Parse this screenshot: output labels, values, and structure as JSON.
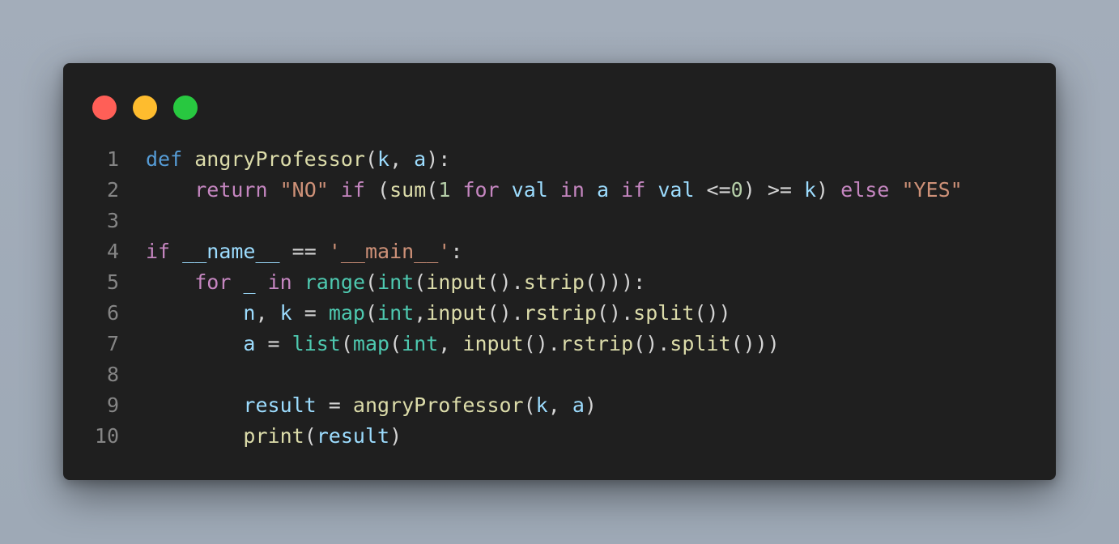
{
  "window": {
    "traffic_lights": [
      {
        "name": "close",
        "color": "#ff5f57"
      },
      {
        "name": "minimize",
        "color": "#febc2e"
      },
      {
        "name": "maximize",
        "color": "#28c840"
      }
    ]
  },
  "colors": {
    "keyword_def": "#569cd6",
    "keyword_control": "#c586c0",
    "function": "#dcdcaa",
    "variable": "#9cdcfe",
    "string": "#ce9178",
    "number": "#b5cea8",
    "builtin": "#4ec9b0",
    "default": "#d4d4d4",
    "line_number": "#858585",
    "background": "#1f1f1f"
  },
  "code": {
    "language": "python",
    "lines": [
      {
        "number": "1",
        "tokens": [
          {
            "t": "def",
            "c": "kw"
          },
          {
            "t": " ",
            "c": "op"
          },
          {
            "t": "angryProfessor",
            "c": "fn"
          },
          {
            "t": "(",
            "c": "op"
          },
          {
            "t": "k",
            "c": "var"
          },
          {
            "t": ", ",
            "c": "op"
          },
          {
            "t": "a",
            "c": "var"
          },
          {
            "t": "):",
            "c": "op"
          }
        ]
      },
      {
        "number": "2",
        "tokens": [
          {
            "t": "    ",
            "c": "op"
          },
          {
            "t": "return",
            "c": "ctl"
          },
          {
            "t": " ",
            "c": "op"
          },
          {
            "t": "\"NO\"",
            "c": "str"
          },
          {
            "t": " ",
            "c": "op"
          },
          {
            "t": "if",
            "c": "ctl"
          },
          {
            "t": " (",
            "c": "op"
          },
          {
            "t": "sum",
            "c": "fn"
          },
          {
            "t": "(",
            "c": "op"
          },
          {
            "t": "1",
            "c": "num"
          },
          {
            "t": " ",
            "c": "op"
          },
          {
            "t": "for",
            "c": "ctl"
          },
          {
            "t": " ",
            "c": "op"
          },
          {
            "t": "val",
            "c": "var"
          },
          {
            "t": " ",
            "c": "op"
          },
          {
            "t": "in",
            "c": "ctl"
          },
          {
            "t": " ",
            "c": "op"
          },
          {
            "t": "a",
            "c": "var"
          },
          {
            "t": " ",
            "c": "op"
          },
          {
            "t": "if",
            "c": "ctl"
          },
          {
            "t": " ",
            "c": "op"
          },
          {
            "t": "val",
            "c": "var"
          },
          {
            "t": " <=",
            "c": "op"
          },
          {
            "t": "0",
            "c": "num"
          },
          {
            "t": ") >= ",
            "c": "op"
          },
          {
            "t": "k",
            "c": "var"
          },
          {
            "t": ") ",
            "c": "op"
          },
          {
            "t": "else",
            "c": "ctl"
          },
          {
            "t": " ",
            "c": "op"
          },
          {
            "t": "\"YES\"",
            "c": "str"
          }
        ]
      },
      {
        "number": "3",
        "tokens": []
      },
      {
        "number": "4",
        "tokens": [
          {
            "t": "if",
            "c": "ctl"
          },
          {
            "t": " ",
            "c": "op"
          },
          {
            "t": "__name__",
            "c": "var"
          },
          {
            "t": " == ",
            "c": "op"
          },
          {
            "t": "'__main__'",
            "c": "str"
          },
          {
            "t": ":",
            "c": "op"
          }
        ]
      },
      {
        "number": "5",
        "tokens": [
          {
            "t": "    ",
            "c": "op"
          },
          {
            "t": "for",
            "c": "ctl"
          },
          {
            "t": " ",
            "c": "op"
          },
          {
            "t": "_",
            "c": "var"
          },
          {
            "t": " ",
            "c": "op"
          },
          {
            "t": "in",
            "c": "ctl"
          },
          {
            "t": " ",
            "c": "op"
          },
          {
            "t": "range",
            "c": "bi"
          },
          {
            "t": "(",
            "c": "op"
          },
          {
            "t": "int",
            "c": "bi"
          },
          {
            "t": "(",
            "c": "op"
          },
          {
            "t": "input",
            "c": "fn"
          },
          {
            "t": "().",
            "c": "op"
          },
          {
            "t": "strip",
            "c": "fn"
          },
          {
            "t": "())):",
            "c": "op"
          }
        ]
      },
      {
        "number": "6",
        "tokens": [
          {
            "t": "        ",
            "c": "op"
          },
          {
            "t": "n",
            "c": "var"
          },
          {
            "t": ", ",
            "c": "op"
          },
          {
            "t": "k",
            "c": "var"
          },
          {
            "t": " = ",
            "c": "op"
          },
          {
            "t": "map",
            "c": "bi"
          },
          {
            "t": "(",
            "c": "op"
          },
          {
            "t": "int",
            "c": "bi"
          },
          {
            "t": ",",
            "c": "op"
          },
          {
            "t": "input",
            "c": "fn"
          },
          {
            "t": "().",
            "c": "op"
          },
          {
            "t": "rstrip",
            "c": "fn"
          },
          {
            "t": "().",
            "c": "op"
          },
          {
            "t": "split",
            "c": "fn"
          },
          {
            "t": "())",
            "c": "op"
          }
        ]
      },
      {
        "number": "7",
        "tokens": [
          {
            "t": "        ",
            "c": "op"
          },
          {
            "t": "a",
            "c": "var"
          },
          {
            "t": " = ",
            "c": "op"
          },
          {
            "t": "list",
            "c": "bi"
          },
          {
            "t": "(",
            "c": "op"
          },
          {
            "t": "map",
            "c": "bi"
          },
          {
            "t": "(",
            "c": "op"
          },
          {
            "t": "int",
            "c": "bi"
          },
          {
            "t": ", ",
            "c": "op"
          },
          {
            "t": "input",
            "c": "fn"
          },
          {
            "t": "().",
            "c": "op"
          },
          {
            "t": "rstrip",
            "c": "fn"
          },
          {
            "t": "().",
            "c": "op"
          },
          {
            "t": "split",
            "c": "fn"
          },
          {
            "t": "()))",
            "c": "op"
          }
        ]
      },
      {
        "number": "8",
        "tokens": []
      },
      {
        "number": "9",
        "tokens": [
          {
            "t": "        ",
            "c": "op"
          },
          {
            "t": "result",
            "c": "var"
          },
          {
            "t": " = ",
            "c": "op"
          },
          {
            "t": "angryProfessor",
            "c": "fn"
          },
          {
            "t": "(",
            "c": "op"
          },
          {
            "t": "k",
            "c": "var"
          },
          {
            "t": ", ",
            "c": "op"
          },
          {
            "t": "a",
            "c": "var"
          },
          {
            "t": ")",
            "c": "op"
          }
        ]
      },
      {
        "number": "10",
        "tokens": [
          {
            "t": "        ",
            "c": "op"
          },
          {
            "t": "print",
            "c": "fn"
          },
          {
            "t": "(",
            "c": "op"
          },
          {
            "t": "result",
            "c": "var"
          },
          {
            "t": ")",
            "c": "op"
          }
        ]
      }
    ]
  }
}
